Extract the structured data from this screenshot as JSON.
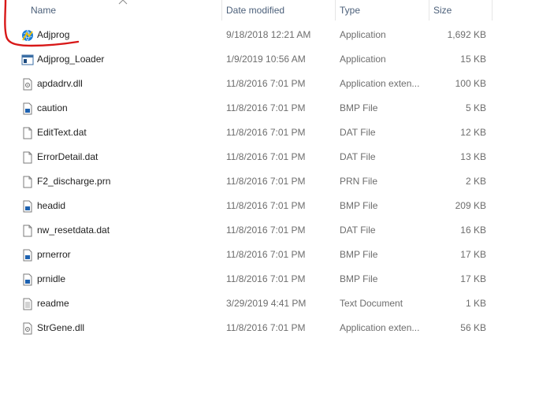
{
  "columns": {
    "name": "Name",
    "date_modified": "Date modified",
    "type": "Type",
    "size": "Size"
  },
  "files": [
    {
      "name": "Adjprog",
      "date": "9/18/2018 12:21 AM",
      "type": "Application",
      "size": "1,692 KB",
      "icon": "app-globe-icon"
    },
    {
      "name": "Adjprog_Loader",
      "date": "1/9/2019 10:56 AM",
      "type": "Application",
      "size": "15 KB",
      "icon": "app-window-icon"
    },
    {
      "name": "apdadrv.dll",
      "date": "11/8/2016 7:01 PM",
      "type": "Application exten...",
      "size": "100 KB",
      "icon": "dll-file-icon"
    },
    {
      "name": "caution",
      "date": "11/8/2016 7:01 PM",
      "type": "BMP File",
      "size": "5 KB",
      "icon": "bmp-file-icon"
    },
    {
      "name": "EditText.dat",
      "date": "11/8/2016 7:01 PM",
      "type": "DAT File",
      "size": "12 KB",
      "icon": "blank-file-icon"
    },
    {
      "name": "ErrorDetail.dat",
      "date": "11/8/2016 7:01 PM",
      "type": "DAT File",
      "size": "13 KB",
      "icon": "blank-file-icon"
    },
    {
      "name": "F2_discharge.prn",
      "date": "11/8/2016 7:01 PM",
      "type": "PRN File",
      "size": "2 KB",
      "icon": "blank-file-icon"
    },
    {
      "name": "headid",
      "date": "11/8/2016 7:01 PM",
      "type": "BMP File",
      "size": "209 KB",
      "icon": "bmp-file-icon"
    },
    {
      "name": "nw_resetdata.dat",
      "date": "11/8/2016 7:01 PM",
      "type": "DAT File",
      "size": "16 KB",
      "icon": "blank-file-icon"
    },
    {
      "name": "prnerror",
      "date": "11/8/2016 7:01 PM",
      "type": "BMP File",
      "size": "17 KB",
      "icon": "bmp-file-icon"
    },
    {
      "name": "prnidle",
      "date": "11/8/2016 7:01 PM",
      "type": "BMP File",
      "size": "17 KB",
      "icon": "bmp-file-icon"
    },
    {
      "name": "readme",
      "date": "3/29/2019 4:41 PM",
      "type": "Text Document",
      "size": "1 KB",
      "icon": "text-file-icon"
    },
    {
      "name": "StrGene.dll",
      "date": "11/8/2016 7:01 PM",
      "type": "Application exten...",
      "size": "56 KB",
      "icon": "dll-file-icon"
    }
  ],
  "colors": {
    "header_text": "#4c607a",
    "secondary_text": "#6d6d6d",
    "annotation_mark": "#d81818"
  }
}
